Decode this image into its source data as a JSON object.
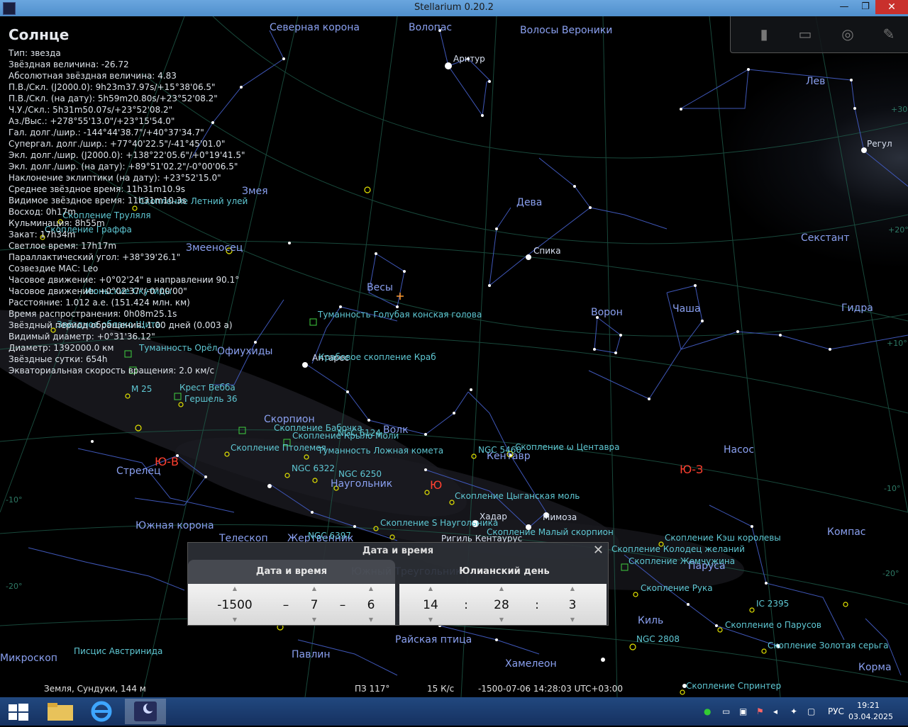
{
  "window": {
    "title": "Stellarium 0.20.2",
    "min": "—",
    "max": "❐",
    "close": "✕"
  },
  "info": {
    "name": "Солнце",
    "lines": [
      "Тип: звезда",
      "Звёздная величина: -26.72",
      "Абсолютная звёздная величина: 4.83",
      "П.В./Скл. (J2000.0): 9h23m37.97s/+15°38'06.5\"",
      "П.В./Скл. (на дату): 5h59m20.80s/+23°52'08.2\"",
      "Ч.У./Скл.: 5h31m50.07s/+23°52'08.2\"",
      "Аз./Выс.: +278°55'13.0\"/+23°15'54.0\"",
      "Гал. долг./шир.: -144°44'38.7\"/+40°37'34.7\"",
      "Супергал. долг./шир.: +77°40'22.5\"/-41°45'01.0\"",
      "Экл. долг./шир. (J2000.0): +138°22'05.6\"/+0°19'41.5\"",
      "Экл. долг./шир. (на дату): +89°51'02.2\"/-0°00'06.5\"",
      "Наклонение эклиптики (на дату): +23°52'15.0\"",
      "Среднее звёздное время: 11h31m10.9s",
      "Видимое звёздное время: 11h31m10.3s",
      "Восход: 0h17m",
      "Кульминация: 8h55m",
      "Закат: 17h34m",
      "Светлое время: 17h17m",
      "Параллактический угол: +38°39'26.1\"",
      "Созвездие МАС: Leo",
      "Часовое движение: +0°02'24\" в направлении 90.1°",
      "Часовое движение: +0°02'37\"/-0°00'00\"",
      "Расстояние: 1.012 а.е. (151.424 млн. км)",
      "Время распространения: 0h08m25.1s",
      "Звёздный период обращения: 1.00 дней (0.003 а)",
      "Видимый диаметр: +0°31'36.12\"",
      "Диаметр: 1392000.0 км",
      "Звёздные сутки: 654h",
      "Экваториальная скорость вращения: 2.0 км/с"
    ]
  },
  "sky_labels": {
    "constellations": [
      {
        "t": "Северная корона"
      },
      {
        "t": "Волопас"
      },
      {
        "t": "Волосы Вероники"
      },
      {
        "t": "Лев"
      },
      {
        "t": "Змея"
      },
      {
        "t": "Дева"
      },
      {
        "t": "Секстант"
      },
      {
        "t": "Змееносец"
      },
      {
        "t": "Весы"
      },
      {
        "t": "Ворон"
      },
      {
        "t": "Чаша"
      },
      {
        "t": "Гидра"
      },
      {
        "t": "Офиухиды"
      },
      {
        "t": "Скорпион"
      },
      {
        "t": "Волк"
      },
      {
        "t": "Кентавр"
      },
      {
        "t": "Насос"
      },
      {
        "t": "Стрелец"
      },
      {
        "t": "Наугольник"
      },
      {
        "t": "Южная корона"
      },
      {
        "t": "Телескоп"
      },
      {
        "t": "Жертвенник"
      },
      {
        "t": "Южный Треугольник"
      },
      {
        "t": "Паруса"
      },
      {
        "t": "Компас"
      },
      {
        "t": "Киль"
      },
      {
        "t": "Райская птица"
      },
      {
        "t": "Павлин"
      },
      {
        "t": "Хамелеон"
      },
      {
        "t": "Корма"
      },
      {
        "t": "Микроскоп"
      }
    ],
    "stars": [
      {
        "t": "Арктур"
      },
      {
        "t": "Регул"
      },
      {
        "t": "Спика"
      },
      {
        "t": "Антарес"
      },
      {
        "t": "Хадар"
      },
      {
        "t": "Мимоза"
      },
      {
        "t": "Ригиль Кентаурус"
      }
    ],
    "objects": [
      {
        "t": "Скопление Летний улей"
      },
      {
        "t": "Скопление Труляля"
      },
      {
        "t": "Скопление Граффа"
      },
      {
        "t": "Июньские Скутиды"
      },
      {
        "t": "Туманность Голубая конская голова"
      },
      {
        "t": "Крабовое скопление Краб"
      },
      {
        "t": "Звёздное облако Щита"
      },
      {
        "t": "Туманность Орёл"
      },
      {
        "t": "M 25"
      },
      {
        "t": "Крест Вебба"
      },
      {
        "t": "Гершель 36"
      },
      {
        "t": "Скопление Бабочка"
      },
      {
        "t": "NGC 6124"
      },
      {
        "t": "Скопление Крыло Моли"
      },
      {
        "t": "Скопление Птолемея"
      },
      {
        "t": "Туманность Ложная комета"
      },
      {
        "t": "NGC 5460"
      },
      {
        "t": "Скопление ω Центавра"
      },
      {
        "t": "NGC 6322"
      },
      {
        "t": "NGC 6250"
      },
      {
        "t": "Скопление Цыганская моль"
      },
      {
        "t": "Скопление S Наугольника"
      },
      {
        "t": "NGC 6397"
      },
      {
        "t": "Скопление Малый скорпион"
      },
      {
        "t": "Скопление Кэш королевы"
      },
      {
        "t": "Скопление Колодец желаний"
      },
      {
        "t": "Скопление Жемчужина"
      },
      {
        "t": "Скопление Рука"
      },
      {
        "t": "IC 2395"
      },
      {
        "t": "Скопление о Парусов"
      },
      {
        "t": "NGC 2808"
      },
      {
        "t": "Скопление Золотая серьга"
      },
      {
        "t": "Скопление Спринтер"
      },
      {
        "t": "Писцис Австринидa"
      }
    ],
    "cardinals": [
      {
        "t": "Ю-В"
      },
      {
        "t": "Ю"
      },
      {
        "t": "Ю-З"
      }
    ],
    "grid": [
      {
        "t": "-10°"
      },
      {
        "t": "-20°"
      },
      {
        "t": "+30°"
      },
      {
        "t": "+20°"
      },
      {
        "t": "+10°"
      },
      {
        "t": "-10°"
      },
      {
        "t": "-20°"
      }
    ]
  },
  "status": {
    "location": "Земля, Сундуки, 144 м",
    "fov": "ПЗ 117°",
    "fps": "15 К/с",
    "datetime": "-1500-07-06 14:28:03 UTC+03:00"
  },
  "dialog": {
    "title": "Дата и время",
    "close": "✕",
    "tab_date": "Дата и время",
    "tab_julian": "Юлианский день",
    "year": "-1500",
    "sep1": "–",
    "month": "7",
    "sep2": "–",
    "day": "6",
    "hour": "14",
    "sep3": ":",
    "minute": "28",
    "sep4": ":",
    "second": "3"
  },
  "taskbar": {
    "lang": "РУС",
    "time": "19:21",
    "date": "03.04.2025"
  },
  "colors": {
    "constellation": "#8aa0f0",
    "object": "#66d0d8",
    "cardinal": "#ff4030",
    "titlebar": "#5b9bd5"
  }
}
